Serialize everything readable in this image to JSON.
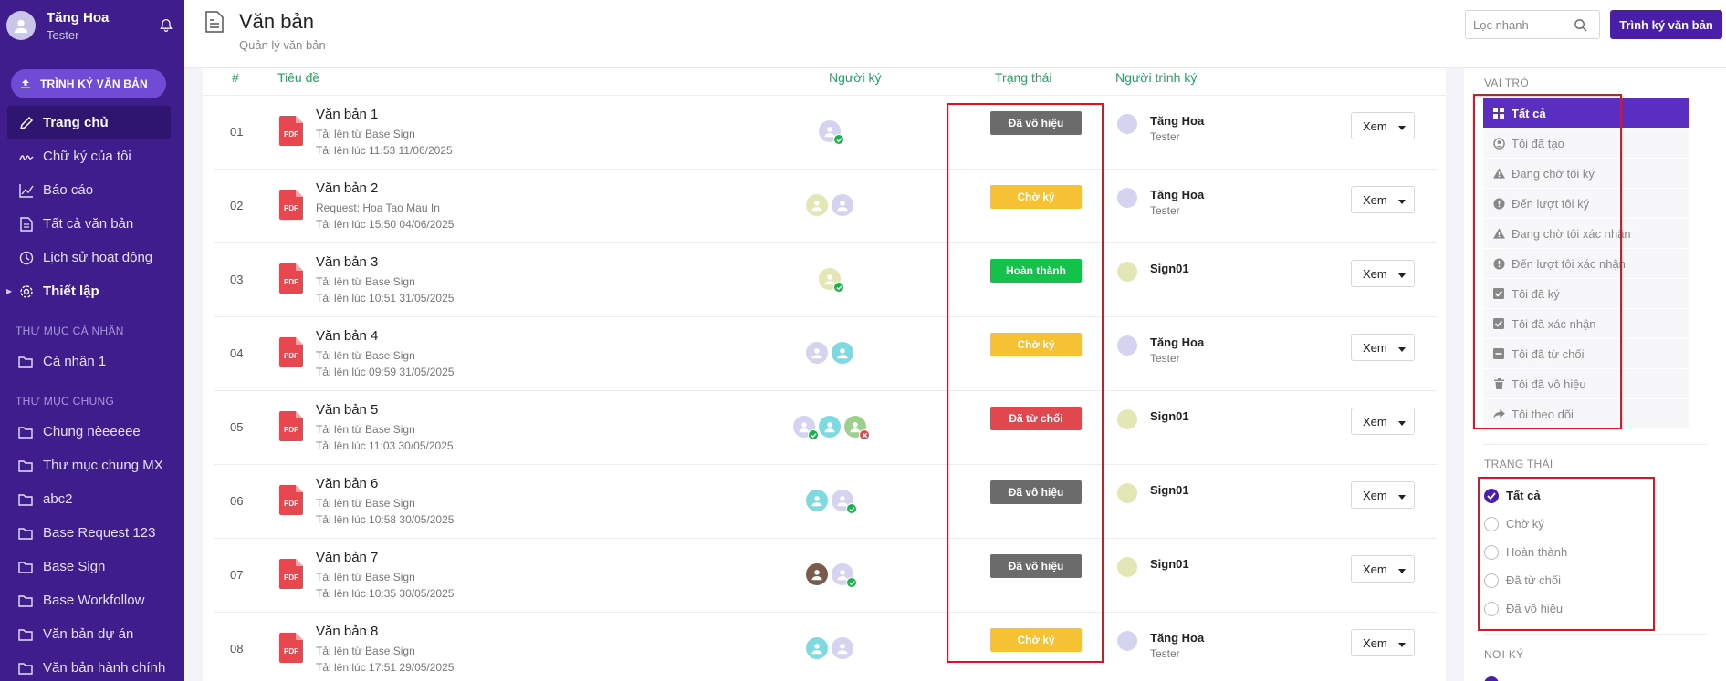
{
  "user": {
    "name": "Tăng Hoa",
    "role": "Tester"
  },
  "sidebar": {
    "submit_label": "TRÌNH KÝ VĂN BẢN",
    "nav": [
      {
        "label": "Trang chủ",
        "icon": "pen-icon"
      },
      {
        "label": "Chữ ký của tôi",
        "icon": "signature-icon"
      },
      {
        "label": "Báo cáo",
        "icon": "chart-icon"
      },
      {
        "label": "Tất cả văn bản",
        "icon": "document-icon"
      },
      {
        "label": "Lịch sử hoạt động",
        "icon": "clock-icon"
      },
      {
        "label": "Thiết lập",
        "icon": "gear-icon"
      }
    ],
    "personal_title": "THƯ MỤC CÁ NHÂN",
    "personal_folders": [
      "Cá nhân 1"
    ],
    "shared_title": "THƯ MỤC CHUNG",
    "shared_folders": [
      "Chung nèeeeee",
      "Thư mục chung MX",
      "abc2",
      "Base Request 123",
      "Base Sign",
      "Base Workfollow",
      "Văn bản dự án",
      "Văn bản hành chính"
    ]
  },
  "header": {
    "title": "Văn bản",
    "subtitle": "Quản lý văn bản",
    "search_placeholder": "Lọc nhanh",
    "submit_label": "Trình ký văn bản"
  },
  "table": {
    "columns": {
      "num": "#",
      "title": "Tiêu đề",
      "signers": "Người ký",
      "status": "Trạng thái",
      "submitter": "Người trình ký"
    },
    "view_label": "Xem",
    "rows": [
      {
        "num": "01",
        "title": "Văn bản 1",
        "line1": "Tải lên từ Base Sign",
        "line2": "Tải lên lúc 11:53 11/06/2025",
        "status": "Đã vô hiệu",
        "submitter": "Tăng Hoa",
        "submitter_role": "Tester"
      },
      {
        "num": "02",
        "title": "Văn bản 2",
        "line1": "Request: Hoa Tao Mau In",
        "line2": "Tải lên lúc 15:50 04/06/2025",
        "status": "Chờ ký",
        "submitter": "Tăng Hoa",
        "submitter_role": "Tester"
      },
      {
        "num": "03",
        "title": "Văn bản 3",
        "line1": "Tải lên từ Base Sign",
        "line2": "Tải lên lúc 10:51 31/05/2025",
        "status": "Hoàn thành",
        "submitter": "Sign01",
        "submitter_role": ""
      },
      {
        "num": "04",
        "title": "Văn bản 4",
        "line1": "Tải lên từ Base Sign",
        "line2": "Tải lên lúc 09:59 31/05/2025",
        "status": "Chờ ký",
        "submitter": "Tăng Hoa",
        "submitter_role": "Tester"
      },
      {
        "num": "05",
        "title": "Văn bản 5",
        "line1": "Tải lên từ Base Sign",
        "line2": "Tải lên lúc 11:03 30/05/2025",
        "status": "Đã từ chối",
        "submitter": "Sign01",
        "submitter_role": ""
      },
      {
        "num": "06",
        "title": "Văn bản 6",
        "line1": "Tải lên từ Base Sign",
        "line2": "Tải lên lúc 10:58 30/05/2025",
        "status": "Đã vô hiệu",
        "submitter": "Sign01",
        "submitter_role": ""
      },
      {
        "num": "07",
        "title": "Văn bản 7",
        "line1": "Tải lên từ Base Sign",
        "line2": "Tải lên lúc 10:35 30/05/2025",
        "status": "Đã vô hiệu",
        "submitter": "Sign01",
        "submitter_role": ""
      },
      {
        "num": "08",
        "title": "Văn bản 8",
        "line1": "Tải lên từ Base Sign",
        "line2": "Tải lên lúc 17:51 29/05/2025",
        "status": "Chờ ký",
        "submitter": "Tăng Hoa",
        "submitter_role": "Tester"
      }
    ]
  },
  "status_colors": {
    "Đã vô hiệu": "#6b6b6b",
    "Chờ ký": "#f6c133",
    "Hoàn thành": "#12c24b",
    "Đã từ chối": "#e0474f"
  },
  "filters": {
    "role_title": "VAI TRÒ",
    "roles": [
      {
        "label": "Tất cả",
        "icon": "grid-icon"
      },
      {
        "label": "Tôi đã tạo",
        "icon": "user-icon"
      },
      {
        "label": "Đang chờ tôi ký",
        "icon": "warning-icon"
      },
      {
        "label": "Đến lượt tôi ký",
        "icon": "alert-icon"
      },
      {
        "label": "Đang chờ tôi xác nhận",
        "icon": "warning-icon"
      },
      {
        "label": "Đến lượt tôi xác nhận",
        "icon": "alert-icon"
      },
      {
        "label": "Tôi đã ký",
        "icon": "checkbox-icon"
      },
      {
        "label": "Tôi đã xác nhận",
        "icon": "checkbox-icon"
      },
      {
        "label": "Tôi đã từ chối",
        "icon": "minus-box-icon"
      },
      {
        "label": "Tôi đã vô hiệu",
        "icon": "trash-icon"
      },
      {
        "label": "Tôi theo dõi",
        "icon": "share-icon"
      }
    ],
    "status_title": "TRẠNG THÁI",
    "statuses": [
      "Tất cả",
      "Chờ ký",
      "Hoàn thành",
      "Đã từ chối",
      "Đã vô hiệu"
    ],
    "sign_place_title": "NƠI KÝ"
  },
  "accent_color": "#4a1fa8"
}
